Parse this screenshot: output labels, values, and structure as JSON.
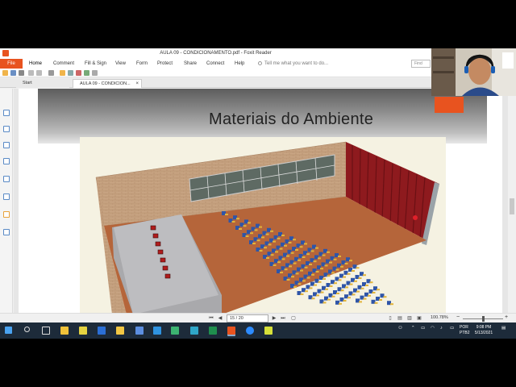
{
  "window": {
    "title": "AULA 09 - CONDICIONAMENTO.pdf - Foxit Reader"
  },
  "menu": {
    "file": "File",
    "items": [
      "Home",
      "Comment",
      "Fill & Sign",
      "View",
      "Form",
      "Protect",
      "Share",
      "Connect",
      "Help"
    ],
    "tell_me": "Tell me what you want to do...",
    "find_placeholder": "Find"
  },
  "tabs": {
    "start": "Start",
    "doc": "AULA 09 - CONDICION..."
  },
  "slide": {
    "title": "Materiais do Ambiente"
  },
  "status": {
    "page_box": "15 / 20",
    "zoom": "100.78%"
  },
  "taskbar": {
    "lang_top": "POR",
    "lang_bottom": "PTB2",
    "time": "9:08 PM",
    "date": "5/13/2021"
  },
  "colors": {
    "accent": "#e8531f",
    "taskbar": "#1d2b3a",
    "curtain": "#8e1a1e",
    "floor": "#b5653a",
    "brick": "#c9a584",
    "chair_blue": "#2f55a8",
    "desk_yellow": "#e2b43a"
  }
}
